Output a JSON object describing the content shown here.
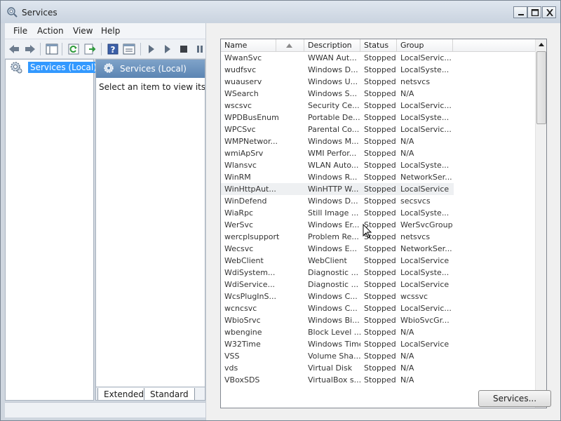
{
  "window": {
    "title": "Services"
  },
  "menu": {
    "file": "File",
    "action": "Action",
    "view": "View",
    "help": "Help"
  },
  "tree": {
    "root_label": "Services (Local)"
  },
  "middle": {
    "header_title": "Services (Local)",
    "description": "Select an item to view its des",
    "tab_extended": "Extended",
    "tab_standard": "Standard"
  },
  "list": {
    "columns": {
      "name": "Name",
      "description": "Description",
      "status": "Status",
      "group": "Group"
    },
    "rows": [
      {
        "name": "WwanSvc",
        "description": "WWAN Aut...",
        "status": "Stopped",
        "group": "LocalServic..."
      },
      {
        "name": "wudfsvc",
        "description": "Windows D...",
        "status": "Stopped",
        "group": "LocalSyste..."
      },
      {
        "name": "wuauserv",
        "description": "Windows U...",
        "status": "Stopped",
        "group": "netsvcs"
      },
      {
        "name": "WSearch",
        "description": "Windows S...",
        "status": "Stopped",
        "group": "N/A"
      },
      {
        "name": "wscsvc",
        "description": "Security Ce...",
        "status": "Stopped",
        "group": "LocalServic..."
      },
      {
        "name": "WPDBusEnum",
        "description": "Portable De...",
        "status": "Stopped",
        "group": "LocalSyste..."
      },
      {
        "name": "WPCSvc",
        "description": "Parental Co...",
        "status": "Stopped",
        "group": "LocalServic..."
      },
      {
        "name": "WMPNetwor...",
        "description": "Windows M...",
        "status": "Stopped",
        "group": "N/A"
      },
      {
        "name": "wmiApSrv",
        "description": "WMI Perfor...",
        "status": "Stopped",
        "group": "N/A"
      },
      {
        "name": "Wlansvc",
        "description": "WLAN Auto...",
        "status": "Stopped",
        "group": "LocalSyste..."
      },
      {
        "name": "WinRM",
        "description": "Windows R...",
        "status": "Stopped",
        "group": "NetworkSer..."
      },
      {
        "name": "WinHttpAut...",
        "description": "WinHTTP W...",
        "status": "Stopped",
        "group": "LocalService"
      },
      {
        "name": "WinDefend",
        "description": "Windows D...",
        "status": "Stopped",
        "group": "secsvcs"
      },
      {
        "name": "WiaRpc",
        "description": "Still Image ...",
        "status": "Stopped",
        "group": "LocalSyste..."
      },
      {
        "name": "WerSvc",
        "description": "Windows Er...",
        "status": "Stopped",
        "group": "WerSvcGroup"
      },
      {
        "name": "wercplsupport",
        "description": "Problem Re...",
        "status": "Stopped",
        "group": "netsvcs"
      },
      {
        "name": "Wecsvc",
        "description": "Windows E...",
        "status": "Stopped",
        "group": "NetworkSer..."
      },
      {
        "name": "WebClient",
        "description": "WebClient",
        "status": "Stopped",
        "group": "LocalService"
      },
      {
        "name": "WdiSystem...",
        "description": "Diagnostic ...",
        "status": "Stopped",
        "group": "LocalSyste..."
      },
      {
        "name": "WdiService...",
        "description": "Diagnostic ...",
        "status": "Stopped",
        "group": "LocalService"
      },
      {
        "name": "WcsPlugInS...",
        "description": "Windows C...",
        "status": "Stopped",
        "group": "wcssvc"
      },
      {
        "name": "wcncsvc",
        "description": "Windows C...",
        "status": "Stopped",
        "group": "LocalServic..."
      },
      {
        "name": "WbioSrvc",
        "description": "Windows Bi...",
        "status": "Stopped",
        "group": "WbioSvcGr..."
      },
      {
        "name": "wbengine",
        "description": "Block Level ...",
        "status": "Stopped",
        "group": "N/A"
      },
      {
        "name": "W32Time",
        "description": "Windows Time",
        "status": "Stopped",
        "group": "LocalService"
      },
      {
        "name": "VSS",
        "description": "Volume Sha...",
        "status": "Stopped",
        "group": "N/A"
      },
      {
        "name": "vds",
        "description": "Virtual Disk",
        "status": "Stopped",
        "group": "N/A"
      },
      {
        "name": "VBoxSDS",
        "description": "VirtualBox s...",
        "status": "Stopped",
        "group": "N/A"
      }
    ]
  },
  "dialog": {
    "services_button": "Services..."
  }
}
